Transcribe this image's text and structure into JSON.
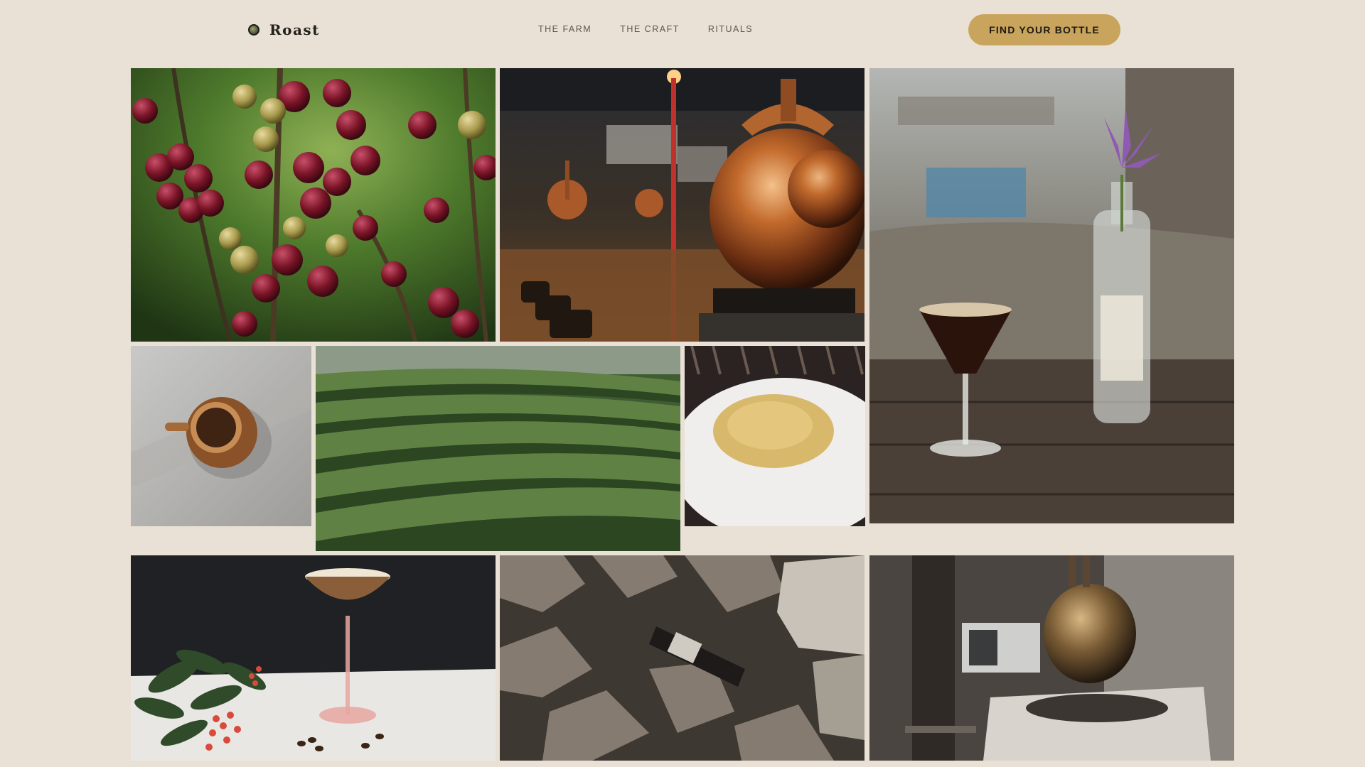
{
  "header": {
    "brand_name": "Roast",
    "brand_icon": "coffee-bean-icon",
    "nav": [
      {
        "label": "THE FARM"
      },
      {
        "label": "THE CRAFT"
      },
      {
        "label": "RITUALS"
      }
    ],
    "cta_label": "FIND YOUR BOTTLE"
  },
  "colors": {
    "background": "#e9e1d5",
    "accent": "#c9a45c",
    "nav_text": "#5e574e",
    "brand_text": "#231f1a"
  },
  "gallery": [
    {
      "subject": "coffee-cherries-photo"
    },
    {
      "subject": "copper-still-photo"
    },
    {
      "subject": "espresso-martini-bottle-photo"
    },
    {
      "subject": "espresso-cup-photo"
    },
    {
      "subject": "tea-plantation-photo"
    },
    {
      "subject": "ground-spice-plate-photo"
    },
    {
      "subject": "coupe-cocktail-photo"
    },
    {
      "subject": "bottle-on-rocks-photo"
    },
    {
      "subject": "antique-still-photo"
    }
  ]
}
